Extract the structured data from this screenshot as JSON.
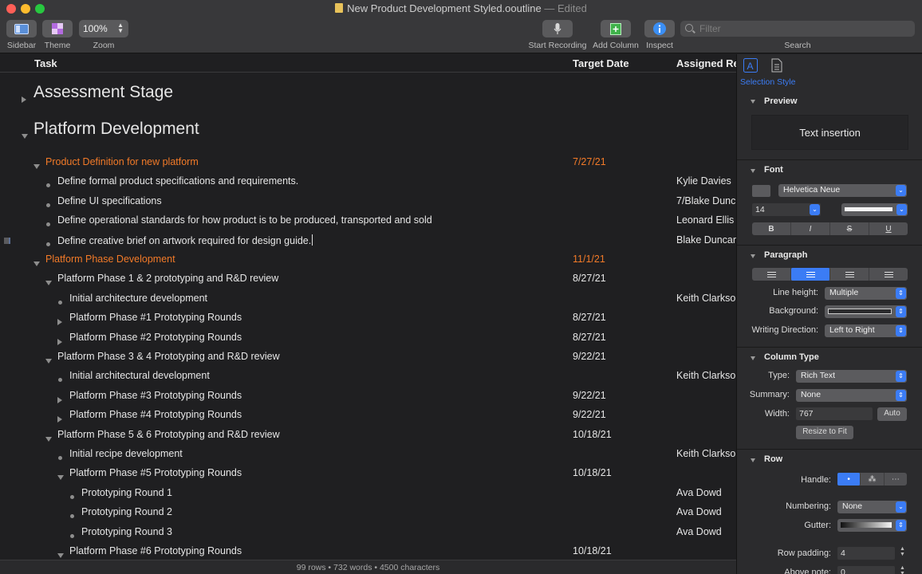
{
  "window": {
    "title": "New Product Development Styled.ooutline",
    "edited": "— Edited"
  },
  "toolbar": {
    "sidebar_label": "Sidebar",
    "theme_label": "Theme",
    "zoom_value": "100%",
    "zoom_label": "Zoom",
    "start_recording_label": "Start Recording",
    "add_column_label": "Add Column",
    "inspect_label": "Inspect",
    "search_placeholder": "Filter",
    "search_label": "Search"
  },
  "columns": {
    "task": "Task",
    "target_date": "Target Date",
    "assigned": "Assigned Re"
  },
  "rows": [
    {
      "level": 0,
      "handle": "closed",
      "style": "h1",
      "task": "Assessment Stage",
      "date": "",
      "assigned": ""
    },
    {
      "level": 0,
      "handle": "open",
      "style": "h1",
      "task": "Platform Development",
      "date": "",
      "assigned": ""
    },
    {
      "level": 1,
      "handle": "open",
      "style": "orange",
      "task": "Product Definition for new platform",
      "date": "7/27/21",
      "assigned": ""
    },
    {
      "level": 2,
      "handle": "bullet",
      "style": "normal",
      "task": "Define formal product specifications and requirements.",
      "date": "",
      "assigned": "Kylie Davies"
    },
    {
      "level": 2,
      "handle": "bullet",
      "style": "normal",
      "task": "Define UI specifications",
      "date": "",
      "assigned": "7/Blake Dunc"
    },
    {
      "level": 2,
      "handle": "bullet",
      "style": "normal",
      "task": "Define operational standards for how product is to be produced, transported and sold",
      "date": "",
      "assigned": "Leonard Ellis"
    },
    {
      "level": 2,
      "handle": "bullet",
      "style": "normal",
      "task": "Define creative brief on artwork required for design guide.",
      "date": "",
      "assigned": "Blake Duncan",
      "editing": true
    },
    {
      "level": 1,
      "handle": "open",
      "style": "orange",
      "task": "Platform Phase Development",
      "date": "11/1/21",
      "assigned": ""
    },
    {
      "level": 2,
      "handle": "open",
      "style": "normal",
      "task": "Platform Phase 1 & 2 prototyping and R&D review",
      "date": "8/27/21",
      "assigned": ""
    },
    {
      "level": 3,
      "handle": "bullet",
      "style": "normal",
      "task": "Initial architecture development",
      "date": "",
      "assigned": "Keith Clarkso"
    },
    {
      "level": 3,
      "handle": "closed",
      "style": "normal",
      "task": "Platform Phase #1 Prototyping Rounds",
      "date": "8/27/21",
      "assigned": ""
    },
    {
      "level": 3,
      "handle": "closed",
      "style": "normal",
      "task": "Platform Phase #2 Prototyping Rounds",
      "date": "8/27/21",
      "assigned": ""
    },
    {
      "level": 2,
      "handle": "open",
      "style": "normal",
      "task": "Platform Phase 3 & 4 Prototyping and R&D review",
      "date": "9/22/21",
      "assigned": ""
    },
    {
      "level": 3,
      "handle": "bullet",
      "style": "normal",
      "task": "Initial architectural development",
      "date": "",
      "assigned": "Keith Clarkso"
    },
    {
      "level": 3,
      "handle": "closed",
      "style": "normal",
      "task": "Platform Phase #3 Prototyping Rounds",
      "date": "9/22/21",
      "assigned": ""
    },
    {
      "level": 3,
      "handle": "closed",
      "style": "normal",
      "task": "Platform Phase #4 Prototyping Rounds",
      "date": "9/22/21",
      "assigned": ""
    },
    {
      "level": 2,
      "handle": "open",
      "style": "normal",
      "task": "Platform Phase 5 & 6 Prototyping and R&D review",
      "date": "10/18/21",
      "assigned": ""
    },
    {
      "level": 3,
      "handle": "bullet",
      "style": "normal",
      "task": "Initial recipe development",
      "date": "",
      "assigned": "Keith Clarkso"
    },
    {
      "level": 3,
      "handle": "open",
      "style": "normal",
      "task": "Platform Phase #5 Prototyping Rounds",
      "date": "10/18/21",
      "assigned": ""
    },
    {
      "level": 4,
      "handle": "bullet",
      "style": "normal",
      "task": "Prototyping Round 1",
      "date": "",
      "assigned": "Ava Dowd"
    },
    {
      "level": 4,
      "handle": "bullet",
      "style": "normal",
      "task": "Prototyping Round 2",
      "date": "",
      "assigned": "Ava Dowd"
    },
    {
      "level": 4,
      "handle": "bullet",
      "style": "normal",
      "task": "Prototyping Round 3",
      "date": "",
      "assigned": "Ava Dowd"
    },
    {
      "level": 3,
      "handle": "open",
      "style": "normal",
      "task": "Platform Phase #6 Prototyping Rounds",
      "date": "10/18/21",
      "assigned": ""
    }
  ],
  "statusbar": "99 rows • 732 words • 4500 characters",
  "inspector": {
    "selection_style": "Selection Style",
    "preview_title": "Preview",
    "preview_text": "Text insertion",
    "font_title": "Font",
    "font_family": "Helvetica Neue",
    "font_size": "14",
    "paragraph_title": "Paragraph",
    "line_height_label": "Line height:",
    "line_height_value": "Multiple",
    "background_label": "Background:",
    "writing_direction_label": "Writing Direction:",
    "writing_direction_value": "Left to Right",
    "column_type_title": "Column Type",
    "type_label": "Type:",
    "type_value": "Rich Text",
    "summary_label": "Summary:",
    "summary_value": "None",
    "width_label": "Width:",
    "width_value": "767",
    "auto_button": "Auto",
    "resize_button": "Resize to Fit",
    "row_title": "Row",
    "handle_label": "Handle:",
    "numbering_label": "Numbering:",
    "numbering_value": "None",
    "gutter_label": "Gutter:",
    "row_padding_label": "Row padding:",
    "row_padding_value": "4",
    "above_note_label": "Above note:",
    "above_note_value": "0"
  },
  "colors": {
    "accent": "#3b7cf5",
    "orange": "#f27a28",
    "background": "#1f1f21"
  }
}
